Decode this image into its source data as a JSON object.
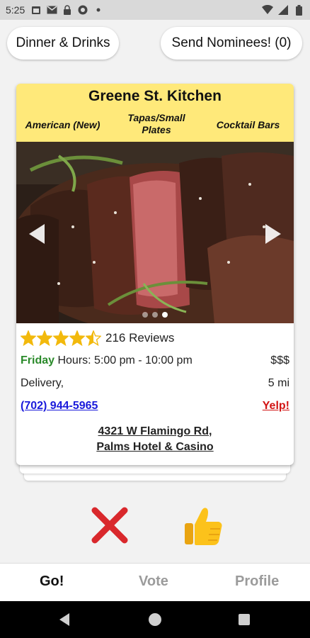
{
  "status_bar": {
    "time": "5:25",
    "icons": [
      "calendar-icon",
      "gmail-icon",
      "lock-icon",
      "app-icon",
      "dot-icon",
      "wifi-icon",
      "signal-icon",
      "battery-icon"
    ]
  },
  "top": {
    "category_button": "Dinner & Drinks",
    "send_button": "Send Nominees! (0)"
  },
  "card": {
    "name": "Greene St. Kitchen",
    "categories": [
      "American (New)",
      "Tapas/Small Plates",
      "Cocktail Bars"
    ],
    "photo_count": 3,
    "photo_index": 3,
    "rating": 4.5,
    "reviews": "216 Reviews",
    "hours_day": "Friday",
    "hours_text": "Hours: 5:00 pm - 10:00 pm",
    "price": "$$$",
    "services": "Delivery,",
    "distance": "5 mi",
    "phone": "(702) 944-5965",
    "yelp_link": "Yelp!",
    "address_line1": "4321 W Flamingo Rd,",
    "address_line2": "Palms Hotel & Casino"
  },
  "actions": {
    "reject_icon": "red-x-icon",
    "like_icon": "thumbs-up-icon"
  },
  "bottom_nav": {
    "go": "Go!",
    "vote": "Vote",
    "profile": "Profile"
  },
  "colors": {
    "header_yellow": "#ffe97a",
    "day_green": "#2a8a2a",
    "link_blue": "#1a1adb",
    "yelp_red": "#d21414",
    "star_gold": "#f2b90c"
  }
}
